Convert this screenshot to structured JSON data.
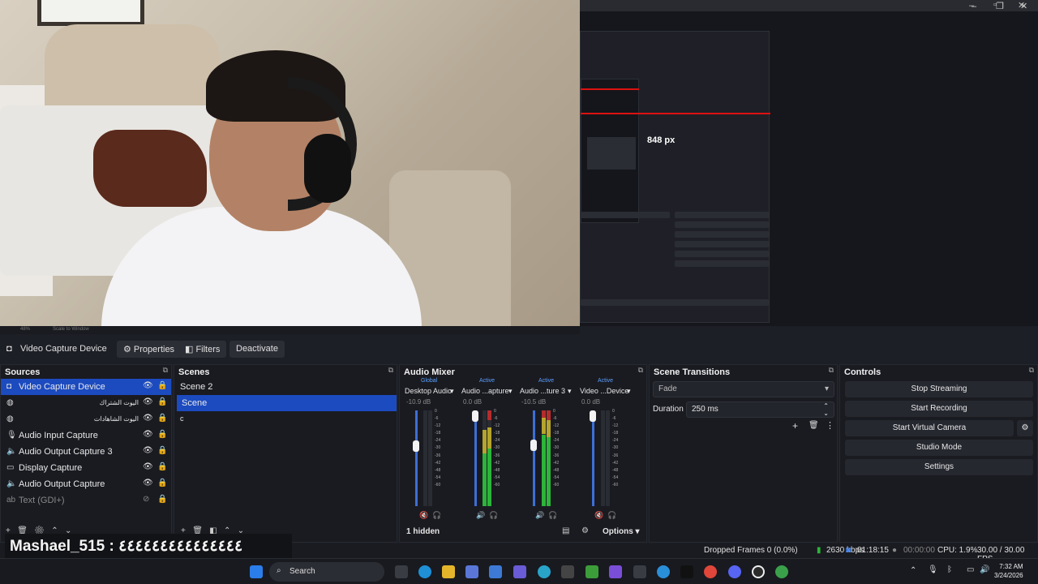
{
  "preview": {
    "inner_label": "848 px",
    "zoom_left": "48%",
    "zoom_mode": "Scale to Window"
  },
  "toolbar": {
    "source_name": "Video Capture Device",
    "properties": "Properties",
    "filters": "Filters",
    "deactivate": "Deactivate"
  },
  "sources": {
    "title": "Sources",
    "items": [
      {
        "label": "Video Capture Device",
        "icon": "camera-icon",
        "selected": true
      },
      {
        "label": "اليوت الشتراك",
        "icon": "globe-icon"
      },
      {
        "label": "اليوت الشاهادات",
        "icon": "globe-icon"
      },
      {
        "label": "Audio Input Capture",
        "icon": "microphone-icon"
      },
      {
        "label": "Audio Output Capture 3",
        "icon": "speaker-icon"
      },
      {
        "label": "Display Capture",
        "icon": "monitor-icon"
      },
      {
        "label": "Audio Output Capture",
        "icon": "speaker-icon"
      },
      {
        "label": "Text (GDI+)",
        "icon": "text-icon",
        "hidden": true
      }
    ]
  },
  "scenes": {
    "title": "Scenes",
    "items": [
      "Scene 2",
      "Scene",
      "c"
    ]
  },
  "mixer": {
    "title": "Audio Mixer",
    "hidden_count": "1 hidden",
    "options": "Options",
    "channels": [
      {
        "status": "Global",
        "name": "Desktop Audio",
        "db": "-10.9 dB",
        "level": 0.0
      },
      {
        "status": "Active",
        "name": "Audio ...apture",
        "db": "0.0 dB",
        "level": 0.55
      },
      {
        "status": "Active",
        "name": "Audio ...ture 3",
        "db": "-10.5 dB",
        "level": 0.75
      },
      {
        "status": "Active",
        "name": "Video ...Device",
        "db": "0.0 dB",
        "level": 0.0
      }
    ],
    "ticks": [
      "0",
      "-6",
      "-12",
      "-18",
      "-24",
      "-30",
      "-36",
      "-42",
      "-48",
      "-54",
      "-60"
    ]
  },
  "transitions": {
    "title": "Scene Transitions",
    "type": "Fade",
    "duration_label": "Duration",
    "duration_value": "250 ms"
  },
  "controls": {
    "title": "Controls",
    "buttons": [
      "Stop Streaming",
      "Start Recording",
      "Start Virtual Camera",
      "Studio Mode",
      "Settings"
    ]
  },
  "status": {
    "dropped": "Dropped Frames 0 (0.0%)",
    "bitrate": "2630 kbps",
    "stream_time": "01:18:15",
    "rec_time": "00:00:00",
    "cpu": "CPU: 1.9%",
    "fps": "30.00 / 30.00 FPS"
  },
  "chat": {
    "text": "Mashael_515 : ٤٤٤٤٤٤٤٤٤٤٤٤٤٤٤"
  },
  "taskbar": {
    "search": "Search",
    "time": "7:32 AM",
    "date": "3/24/2026"
  }
}
